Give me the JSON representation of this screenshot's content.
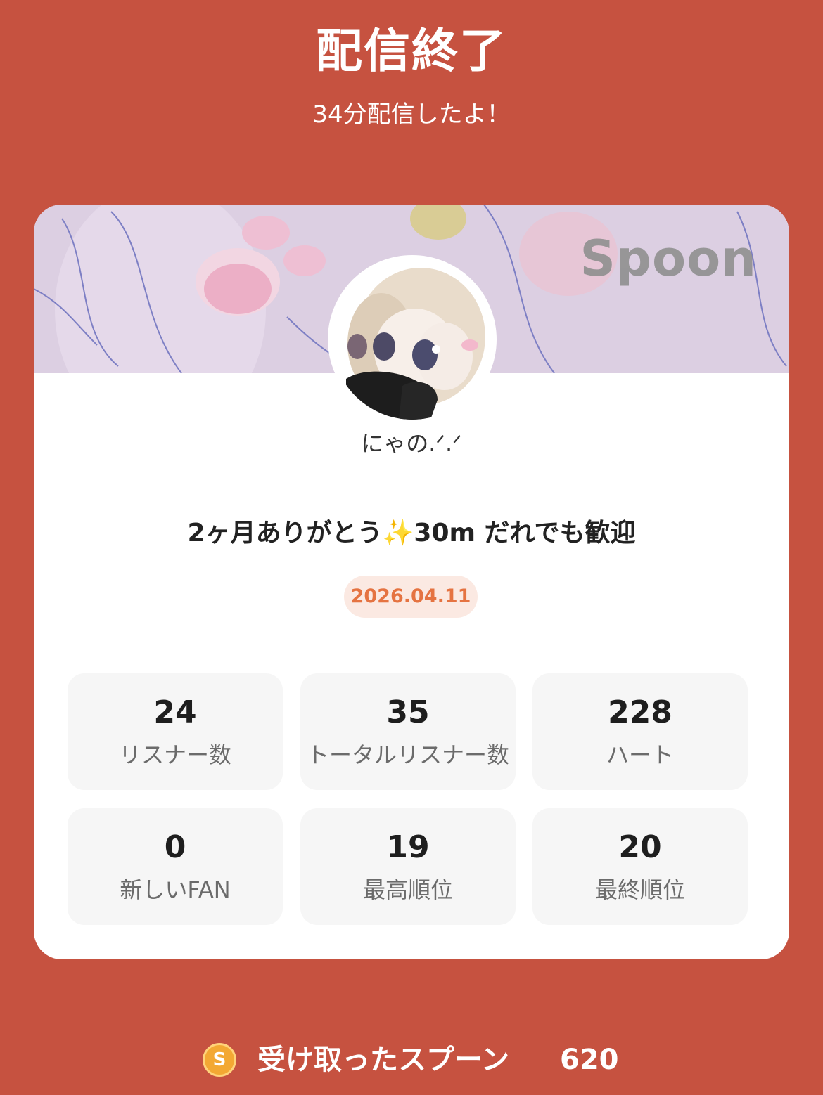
{
  "header": {
    "title": "配信終了",
    "subtitle": "34分配信したよ！"
  },
  "card": {
    "banner_logo": "Spoon",
    "username": "にゃの.ᐟ.ᐟ",
    "broadcast_title": "2ヶ月ありがとう✨30m だれでも歓迎",
    "date": "2026.04.11"
  },
  "stats": [
    {
      "value": "24",
      "label": "リスナー数"
    },
    {
      "value": "35",
      "label": "トータルリスナー数"
    },
    {
      "value": "228",
      "label": "ハート"
    },
    {
      "value": "0",
      "label": "新しいFAN"
    },
    {
      "value": "19",
      "label": "最高順位"
    },
    {
      "value": "20",
      "label": "最終順位"
    }
  ],
  "footer": {
    "coin_icon": "spoon-coin-icon",
    "coin_letter": "S",
    "label": "受け取ったスプーン",
    "value": "620"
  },
  "colors": {
    "background": "#c65240",
    "card": "#ffffff",
    "date_badge_bg": "#fbe9e2",
    "date_badge_text": "#e57341",
    "stat_bg": "#f6f6f6",
    "coin": "#f3a833"
  }
}
